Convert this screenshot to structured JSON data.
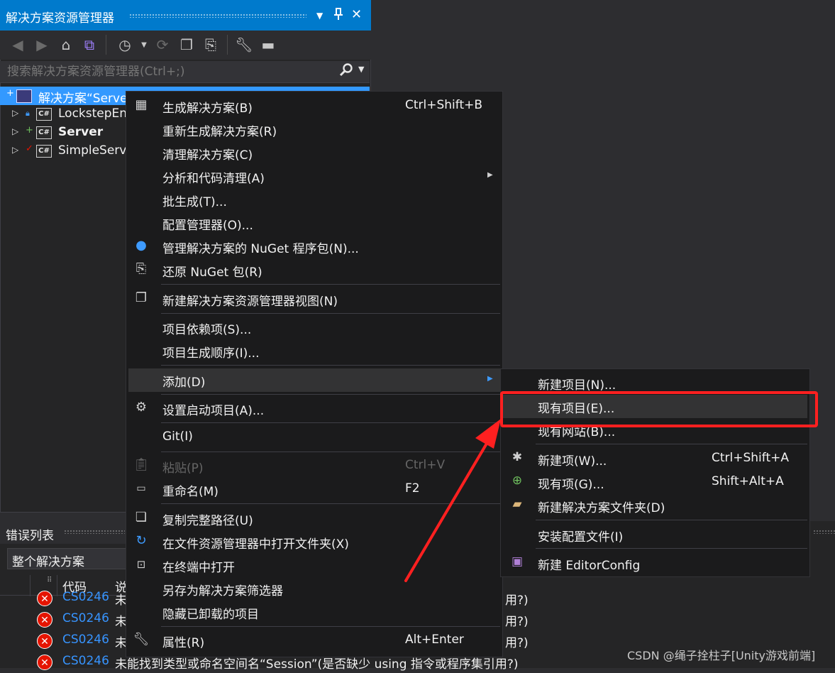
{
  "solution_explorer": {
    "title": "解决方案资源管理器",
    "title_buttons": [
      "▾",
      "pin",
      "✕"
    ],
    "search_placeholder": "搜索解决方案资源管理器(Ctrl+;)",
    "tree": [
      {
        "label": "解决方案“Serve",
        "type": "solution",
        "selected": true
      },
      {
        "label": "LockstepEn",
        "type": "project",
        "status": "lock"
      },
      {
        "label": "Server",
        "type": "project",
        "status": "plus",
        "bold": true
      },
      {
        "label": "SimpleServ",
        "type": "project",
        "status": "check"
      }
    ]
  },
  "error_list": {
    "title": "错误列表",
    "scope": "整个解决方案",
    "columns": {
      "code": "代码",
      "desc": "说"
    },
    "rows": [
      {
        "code": "CS0246",
        "desc": "未",
        "tail": "用?)"
      },
      {
        "code": "CS0246",
        "desc": "未",
        "tail": "用?)"
      },
      {
        "code": "CS0246",
        "desc": "未",
        "tail": "用?)"
      },
      {
        "code": "CS0246",
        "desc": "未能找到类型或命名空间名“Session”(是否缺少 using 指令或程序集引用?)",
        "tail": ""
      }
    ]
  },
  "context_menu": {
    "items": {
      "build": {
        "label": "生成解决方案(B)",
        "shortcut": "Ctrl+Shift+B"
      },
      "rebuild": {
        "label": "重新生成解决方案(R)"
      },
      "clean": {
        "label": "清理解决方案(C)"
      },
      "analyze": {
        "label": "分析和代码清理(A)"
      },
      "batch": {
        "label": "批生成(T)..."
      },
      "config": {
        "label": "配置管理器(O)..."
      },
      "nuget_manage": {
        "label": "管理解决方案的 NuGet 程序包(N)..."
      },
      "nuget_restore": {
        "label": "还原 NuGet 包(R)"
      },
      "new_view": {
        "label": "新建解决方案资源管理器视图(N)"
      },
      "deps": {
        "label": "项目依赖项(S)..."
      },
      "build_order": {
        "label": "项目生成顺序(I)..."
      },
      "add": {
        "label": "添加(D)"
      },
      "startup": {
        "label": "设置启动项目(A)..."
      },
      "git": {
        "label": "Git(I)"
      },
      "paste": {
        "label": "粘贴(P)",
        "shortcut": "Ctrl+V"
      },
      "rename": {
        "label": "重命名(M)",
        "shortcut": "F2"
      },
      "copy_path": {
        "label": "复制完整路径(U)"
      },
      "open_folder": {
        "label": "在文件资源管理器中打开文件夹(X)"
      },
      "terminal": {
        "label": "在终端中打开"
      },
      "save_filter": {
        "label": "另存为解决方案筛选器"
      },
      "hide_unloaded": {
        "label": "隐藏已卸载的项目"
      },
      "properties": {
        "label": "属性(R)",
        "shortcut": "Alt+Enter"
      }
    }
  },
  "add_submenu": {
    "new_project": {
      "label": "新建项目(N)..."
    },
    "existing_project": {
      "label": "现有项目(E)..."
    },
    "existing_website": {
      "label": "现有网站(B)..."
    },
    "new_item": {
      "label": "新建项(W)...",
      "shortcut": "Ctrl+Shift+A"
    },
    "existing_item": {
      "label": "现有项(G)...",
      "shortcut": "Shift+Alt+A"
    },
    "new_folder": {
      "label": "新建解决方案文件夹(D)"
    },
    "install_config": {
      "label": "安装配置文件(I)"
    },
    "editorconfig": {
      "label": "新建 EditorConfig"
    }
  },
  "annotation": {
    "highlight_color": "#ff2020"
  },
  "watermark": "CSDN @绳子拴柱子[Unity游戏前端]",
  "colors": {
    "accent": "#007acc",
    "selection": "#3399ff",
    "menu_bg": "#1b1b1c",
    "error": "#e51400",
    "link": "#3794ff"
  }
}
